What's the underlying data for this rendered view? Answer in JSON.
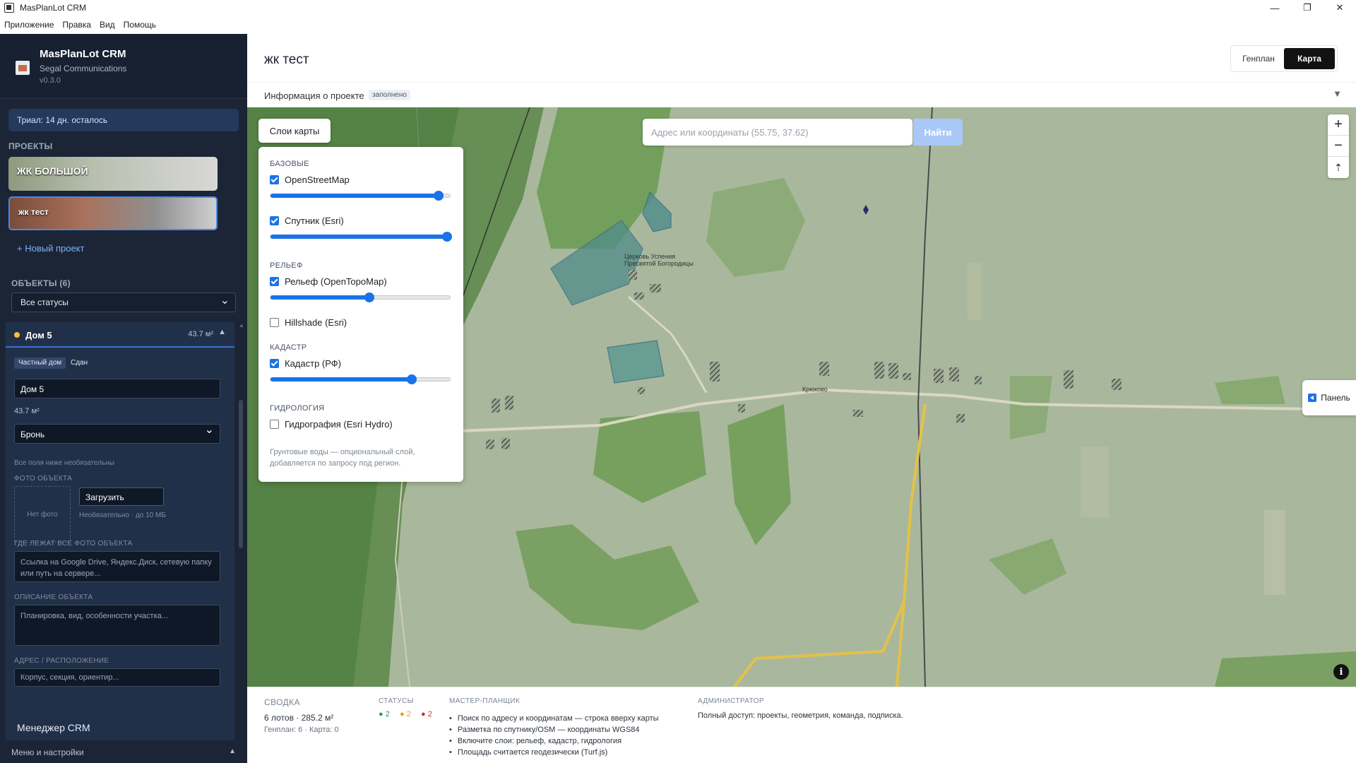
{
  "window": {
    "title": "MasPlanLot CRM",
    "minimize": "—",
    "maximize": "❐",
    "close": "✕"
  },
  "menu": [
    "Приложение",
    "Правка",
    "Вид",
    "Помощь"
  ],
  "sidebar": {
    "brand_name": "MasPlanLot CRM",
    "company": "Segal Communications",
    "version": "v0.3.0",
    "trial": "Триал: 14 дн. осталось",
    "projects_label": "ПРОЕКТЫ",
    "projects": [
      {
        "name": "ЖК БОЛЬШОЙ"
      },
      {
        "name": "жк тест"
      }
    ],
    "new_project": "+ Новый проект",
    "objects_label": "ОБЪЕКТЫ (6)",
    "status_filter": "Все статусы",
    "object": {
      "name": "Дом 5",
      "area": "43.7 м²",
      "tag_type": "Частный дом",
      "tag_state": "Сдан",
      "name_value": "Дом 5",
      "area_value": "43.7 м²",
      "status_value": "Бронь",
      "optional_note": "Все поля ниже необязательны",
      "photo_label": "ФОТО ОБЪЕКТА",
      "no_photo": "Нет фото",
      "upload": "Загрузить",
      "upload_hint": "Необязательно · до 10 МБ",
      "photos_location_label": "ГДЕ ЛЕЖАТ ВСЕ ФОТО ОБЪЕКТА",
      "photos_location_placeholder": "Ссылка на Google Drive, Яндекс.Диск, сетевую папку или путь на сервере...",
      "description_label": "ОПИСАНИЕ ОБЪЕКТА",
      "description_placeholder": "Планировка, вид, особенности участка...",
      "address_label": "АДРЕС / РАСПОЛОЖЕНИЕ",
      "address_placeholder": "Корпус, секция, ориентир..."
    },
    "crm_manager": "Менеджер CRM",
    "menu_settings": "Меню и настройки"
  },
  "main": {
    "title": "жк тест",
    "view_tabs": [
      "Генплан",
      "Карта"
    ],
    "active_view": "Карта",
    "info_label": "Информация о проекте",
    "info_badge": "заполнено"
  },
  "map": {
    "layers_button": "Слои карты",
    "search_placeholder": "Адрес или координаты (55.75, 37.62)",
    "search_button": "Найти",
    "panel_button": "Панель",
    "place_labels": [
      "Церковь Успения",
      "Пресвятой Богородицы",
      "Крюково"
    ],
    "layers": {
      "base_label": "БАЗОВЫЕ",
      "relief_label": "РЕЛЬЕФ",
      "cadastre_label": "КАДАСТР",
      "hydro_label": "ГИДРОЛОГИЯ",
      "items": [
        {
          "name": "OpenStreetMap",
          "checked": true,
          "opacity": 0.93
        },
        {
          "name": "Спутник (Esri)",
          "checked": true,
          "opacity": 1.0
        },
        {
          "name": "Рельеф (OpenTopoMap)",
          "checked": true,
          "opacity": 0.55
        },
        {
          "name": "Hillshade (Esri)",
          "checked": false
        },
        {
          "name": "Кадастр (РФ)",
          "checked": true,
          "opacity": 0.78
        },
        {
          "name": "Гидрография (Esri Hydro)",
          "checked": false
        }
      ],
      "note": "Грунтовые воды — опциональный слой, добавляется по запросу под регион."
    }
  },
  "bottom": {
    "summary_label": "СВОДКА",
    "summary_text": "6 лотов · 285.2 м²",
    "summary_sub": "Генплан: 6 · Карта: 0",
    "statuses_label": "СТАТУСЫ",
    "statuses": [
      {
        "text": "● 2",
        "color": "#2e9e4a"
      },
      {
        "text": "● 2",
        "color": "#e0a020"
      },
      {
        "text": "● 2",
        "color": "#d03030"
      }
    ],
    "wizard_label": "МАСТЕР-ПЛАНЩИК",
    "wizard_items": [
      "Поиск по адресу и координатам — строка вверху карты",
      "Разметка по спутнику/OSM — координаты WGS84",
      "Включите слои: рельеф, кадастр, гидрология",
      "Площадь считается геодезически (Turf.js)"
    ],
    "admin_label": "АДМИНИСТРАТОР",
    "admin_text": "Полный доступ: проекты, геометрия, команда, подписка."
  },
  "colors": {
    "sidebar_bg": "#1b2535",
    "accent": "#1a73e8",
    "active_border": "#3b6fd1"
  }
}
